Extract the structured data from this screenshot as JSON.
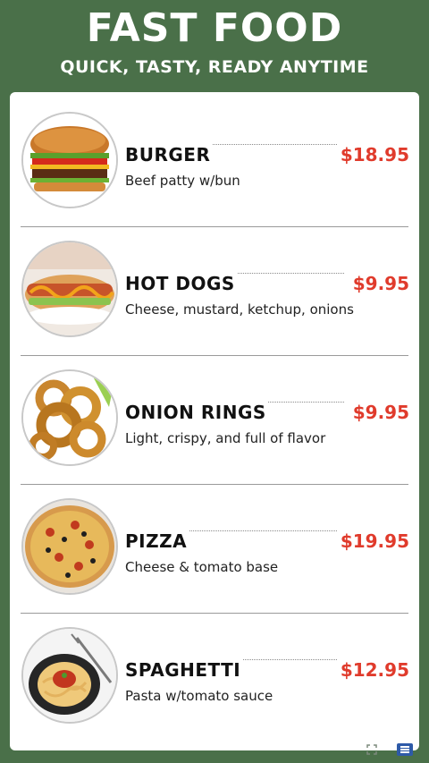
{
  "header": {
    "title": "FAST FOOD",
    "subtitle": "QUICK, TASTY, READY ANYTIME"
  },
  "colors": {
    "background": "#4a7049",
    "card": "#ffffff",
    "price": "#e03b2c",
    "text": "#111111"
  },
  "menu": {
    "items": [
      {
        "name": "BURGER",
        "price": "$18.95",
        "description": "Beef patty w/bun",
        "image": "burger-photo"
      },
      {
        "name": "HOT DOGS",
        "price": "$9.95",
        "description": "Cheese, mustard, ketchup, onions",
        "image": "hot-dog-photo"
      },
      {
        "name": "ONION RINGS",
        "price": "$9.95",
        "description": "Light, crispy, and full of flavor",
        "image": "onion-rings-photo"
      },
      {
        "name": "PIZZA",
        "price": "$19.95",
        "description": "Cheese & tomato base",
        "image": "pizza-photo"
      },
      {
        "name": "SPAGHETTI",
        "price": "$12.95",
        "description": "Pasta w/tomato sauce",
        "image": "spaghetti-photo"
      }
    ]
  },
  "corner_icons": [
    "fullscreen-icon",
    "menu-icon"
  ]
}
